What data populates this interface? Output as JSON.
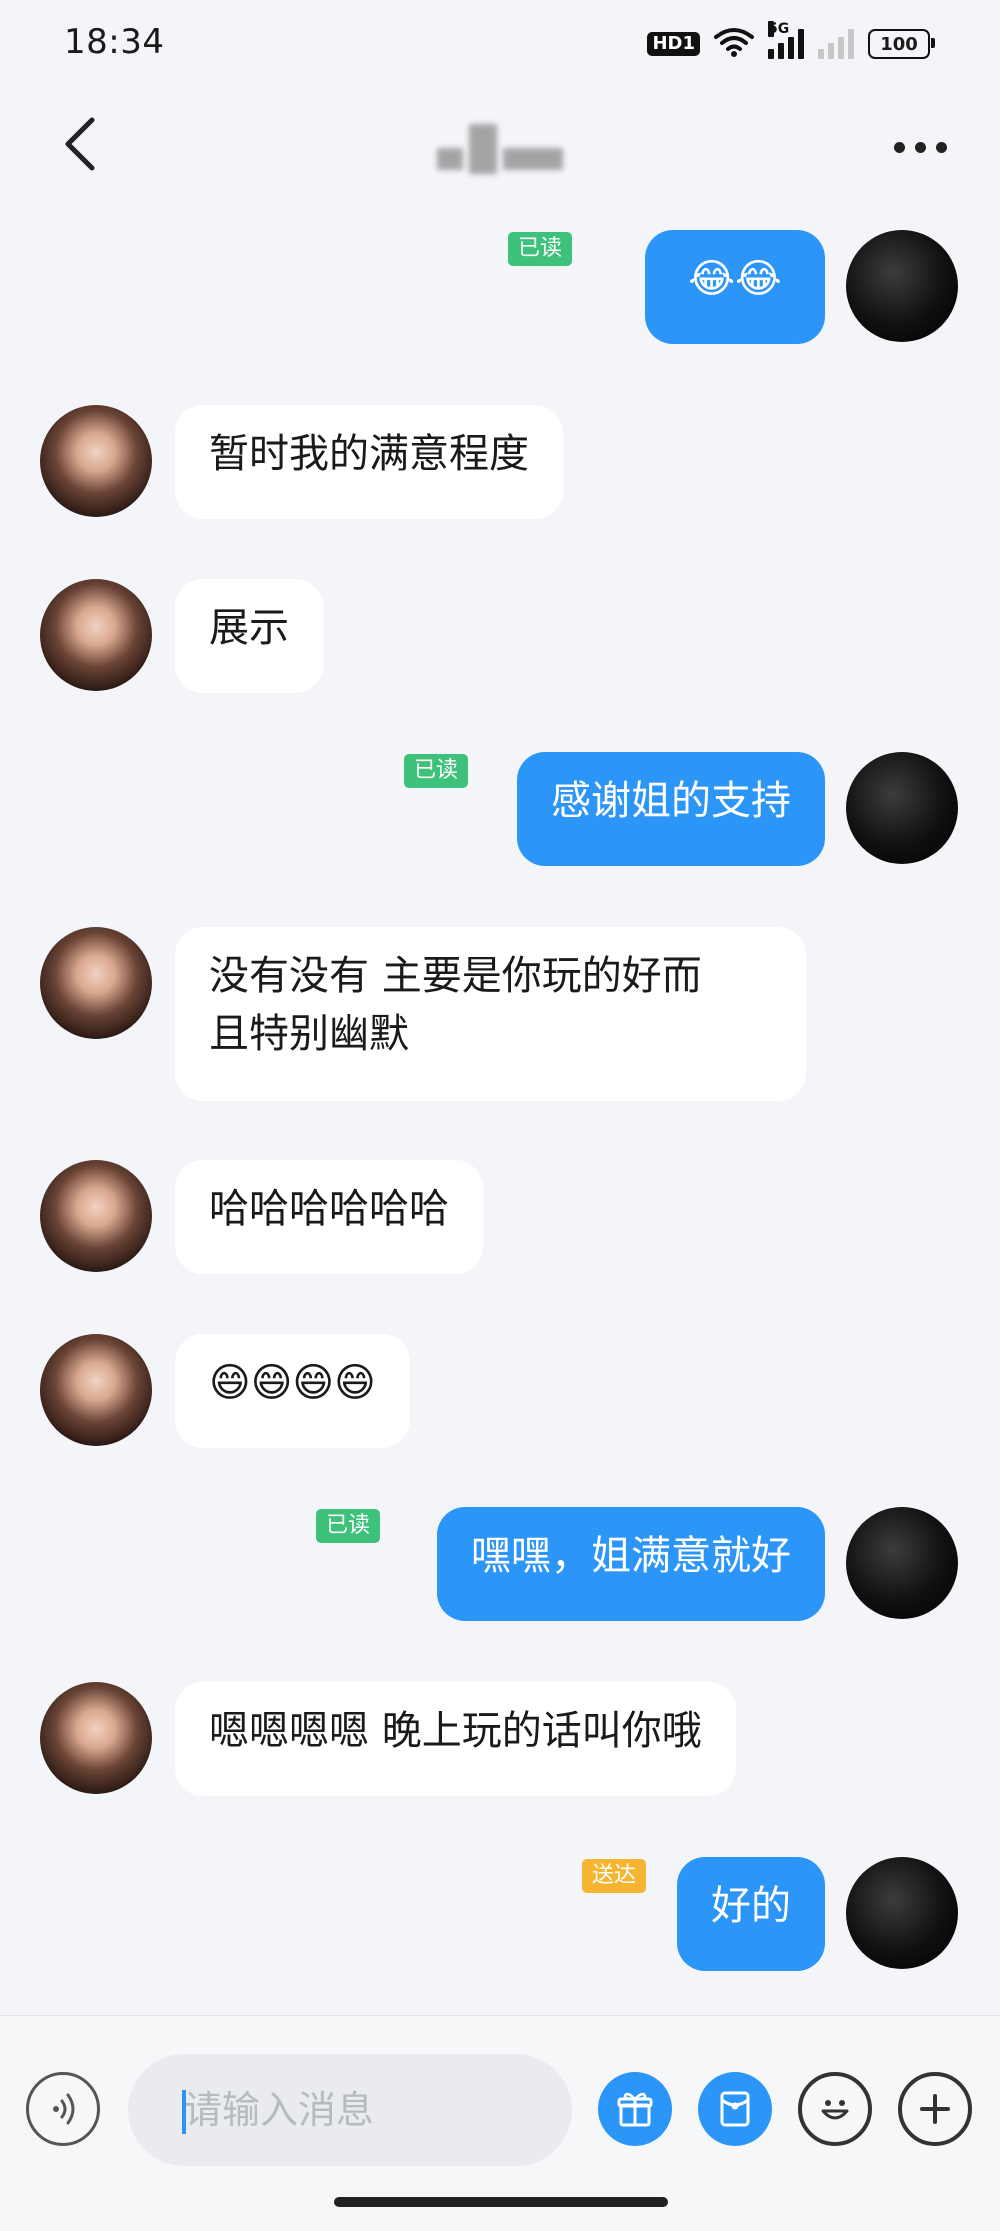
{
  "status_bar": {
    "time": "18:34",
    "hd_label": "HD1",
    "network_label": "5G",
    "battery_level": "100"
  },
  "nav": {
    "back_icon": "chevron-left-icon",
    "more_icon": "more-horizontal-icon"
  },
  "messages": [
    {
      "from": "me",
      "text": "😂😂",
      "status": "已读"
    },
    {
      "from": "her",
      "text": "暂时我的满意程度"
    },
    {
      "from": "her",
      "text": "展示"
    },
    {
      "from": "me",
      "text": "感谢姐的支持",
      "status": "已读"
    },
    {
      "from": "her",
      "text": "没有没有 主要是你玩的好而\n且特别幽默"
    },
    {
      "from": "her",
      "text": "哈哈哈哈哈哈"
    },
    {
      "from": "her",
      "text": "😄😄😄😄"
    },
    {
      "from": "me",
      "text": "嘿嘿，姐满意就好",
      "status": "已读"
    },
    {
      "from": "her",
      "text": "嗯嗯嗯嗯 晚上玩的话叫你哦"
    },
    {
      "from": "me",
      "text": "好的",
      "status": "送达"
    }
  ],
  "input_bar": {
    "placeholder": "请输入消息",
    "voice_icon": "voice-icon",
    "gift_icon": "gift-icon",
    "red_packet_icon": "red-packet-icon",
    "emoji_icon": "emoji-icon",
    "plus_icon": "plus-icon"
  },
  "colors": {
    "background": "#f3f5f9",
    "outgoing_bubble": "#2c95f8",
    "incoming_bubble": "#ffffff",
    "read_badge": "#3ec17a",
    "sent_badge": "#f6b531"
  }
}
